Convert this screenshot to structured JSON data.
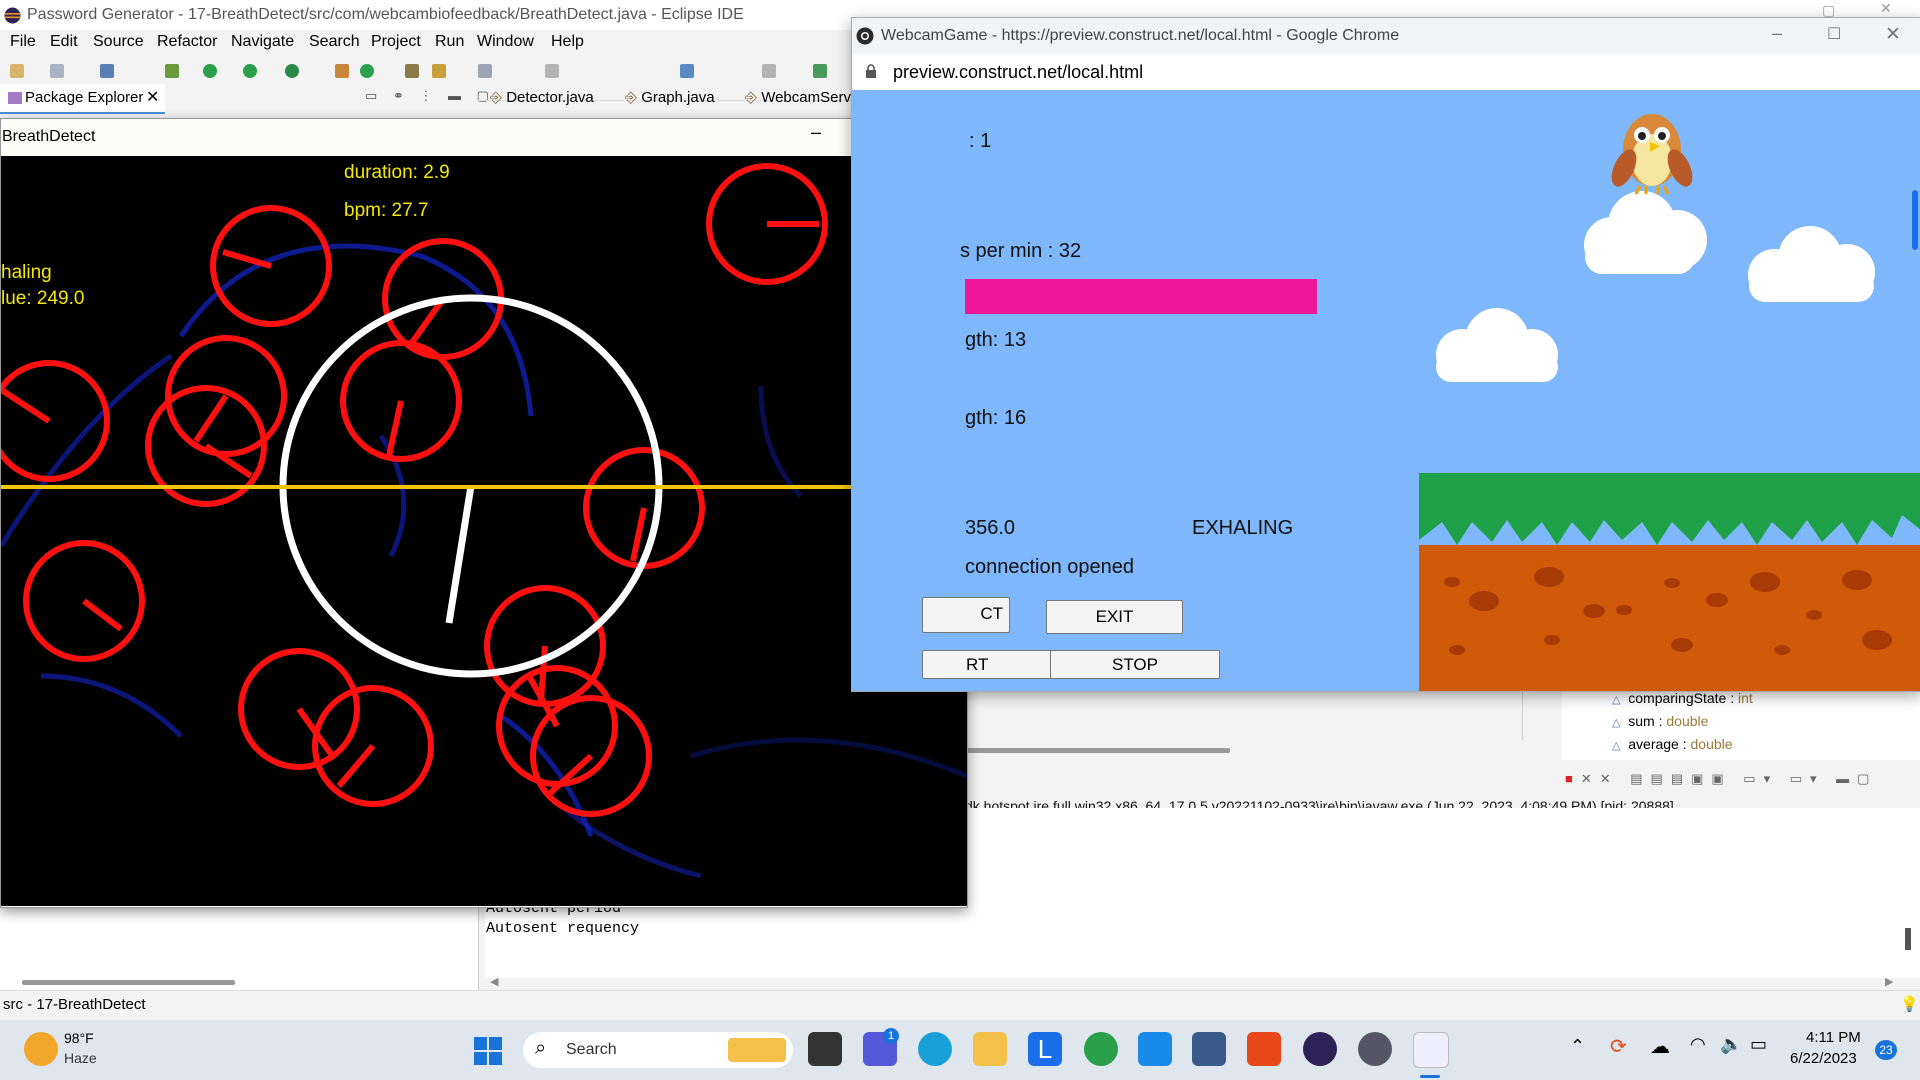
{
  "eclipse": {
    "title": "Password Generator - 17-BreathDetect/src/com/webcambiofeedback/BreathDetect.java - Eclipse IDE",
    "menu": [
      "File",
      "Edit",
      "Source",
      "Refactor",
      "Navigate",
      "Search",
      "Project",
      "Run",
      "Window",
      "Help"
    ],
    "package_explorer_tab": "Package Explorer",
    "editor_tabs": [
      "Detector.java",
      "Graph.java",
      "WebcamServ"
    ],
    "outline_items": [
      {
        "name": "comparingState",
        "type": "int"
      },
      {
        "name": "sum",
        "type": "double"
      },
      {
        "name": "average",
        "type": "double"
      }
    ],
    "console_header": "dk.hotspot.jre.full.win32.x86_64_17.0.5.v20221102-0933\\jre\\bin\\javaw.exe  (Jun 22, 2023, 4:08:49 PM) [pid: 20888]",
    "console_lines": [
      "Autosent period",
      "Autosent requency"
    ],
    "status_text": "src - 17-BreathDetect"
  },
  "breathdetect": {
    "title": "BreathDetect",
    "duration": "duration: 2.9",
    "bpm": "bpm: 27.7",
    "state": "haling",
    "value": "lue: 249.0"
  },
  "chrome": {
    "title": "WebcamGame - https://preview.construct.net/local.html - Google Chrome",
    "url": "preview.construct.net/local.html",
    "game": {
      "line1": ": 1",
      "line2": "s per min : 32",
      "line3": "gth: 13",
      "line4": "gth: 16",
      "line5": "356.0",
      "state": "EXHALING",
      "connection": "connection opened",
      "btn_connect": "CT",
      "btn_exit": "EXIT",
      "btn_start": "RT",
      "btn_stop": "STOP",
      "bar_color": "#f0169a",
      "bar_level_percent": 100
    }
  },
  "taskbar": {
    "temp": "98°F",
    "weather": "Haze",
    "search": "Search",
    "time": "4:11 PM",
    "date": "6/22/2023",
    "notifications": "23",
    "teams_badge": "1"
  }
}
